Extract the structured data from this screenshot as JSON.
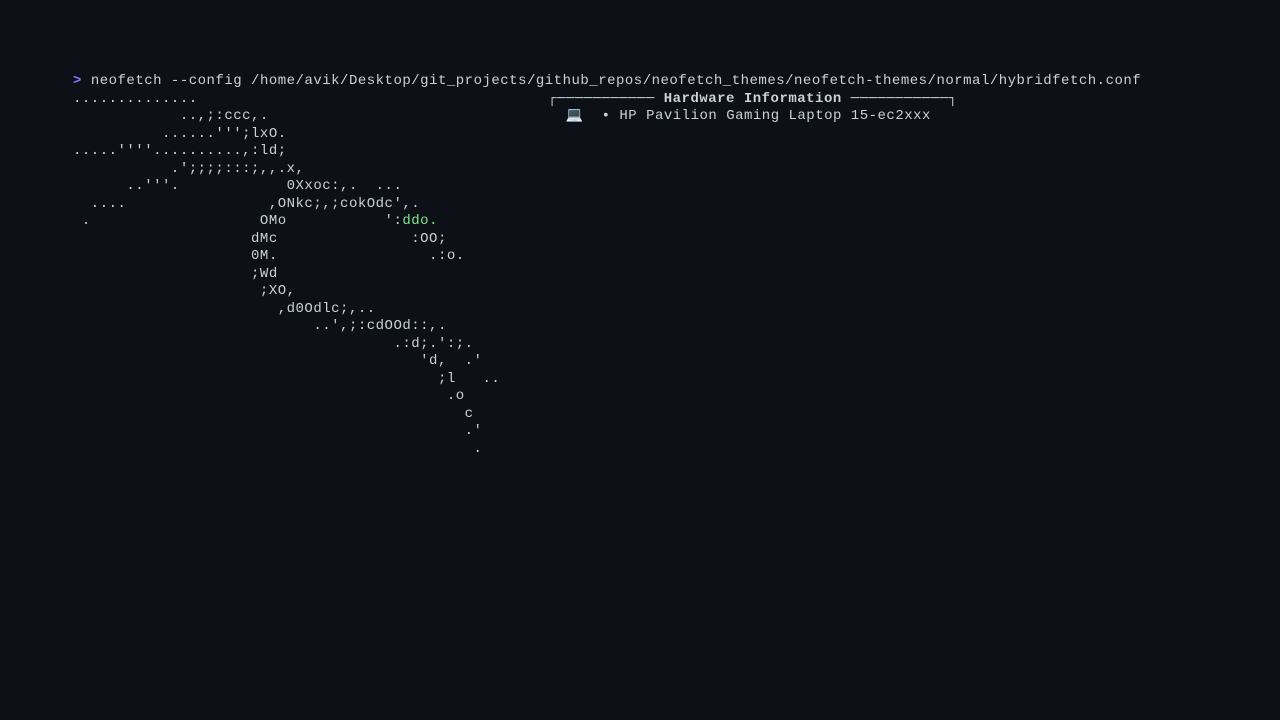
{
  "prompt": {
    "symbol": ">",
    "command": "neofetch --config /home/avik/Desktop/git_projects/github_repos/neofetch_themes/neofetch-themes/normal/hybridfetch.conf"
  },
  "ascii": [
    "..............",
    "            ..,;:ccc,.",
    "          ......''';lxO.",
    ".....''''..........,:ld;",
    "           .';;;;:::;,,.x,",
    "      ..'''.            0Xxoc:,.  ...",
    "  ....                ,ONkc;,;cokOdc',.",
    " .                   OMo           ':",
    "                    dMc               :OO;",
    "                    0M.                 .:o.",
    "                    ;Wd",
    "                     ;XO,",
    "                       ,d0Odlc;,..",
    "                           ..',;:cdOOd::,.",
    "                                    .:d;.':;.",
    "                                       'd,  .'",
    "                                         ;l   ..",
    "                                          .o",
    "                                            c",
    "                                            .'",
    "                                             ."
  ],
  "ascii_green_fragment": "ddo.",
  "info": {
    "section_title": "Hardware Information",
    "host_icon": "💻",
    "host_bullet": "•",
    "host_value": "HP Pavilion Gaming Laptop 15-ec2xxx"
  },
  "box": {
    "left_corner": "┌",
    "right_corner": "┐",
    "dash_left": "─────────── ",
    "dash_right": " ───────────"
  }
}
